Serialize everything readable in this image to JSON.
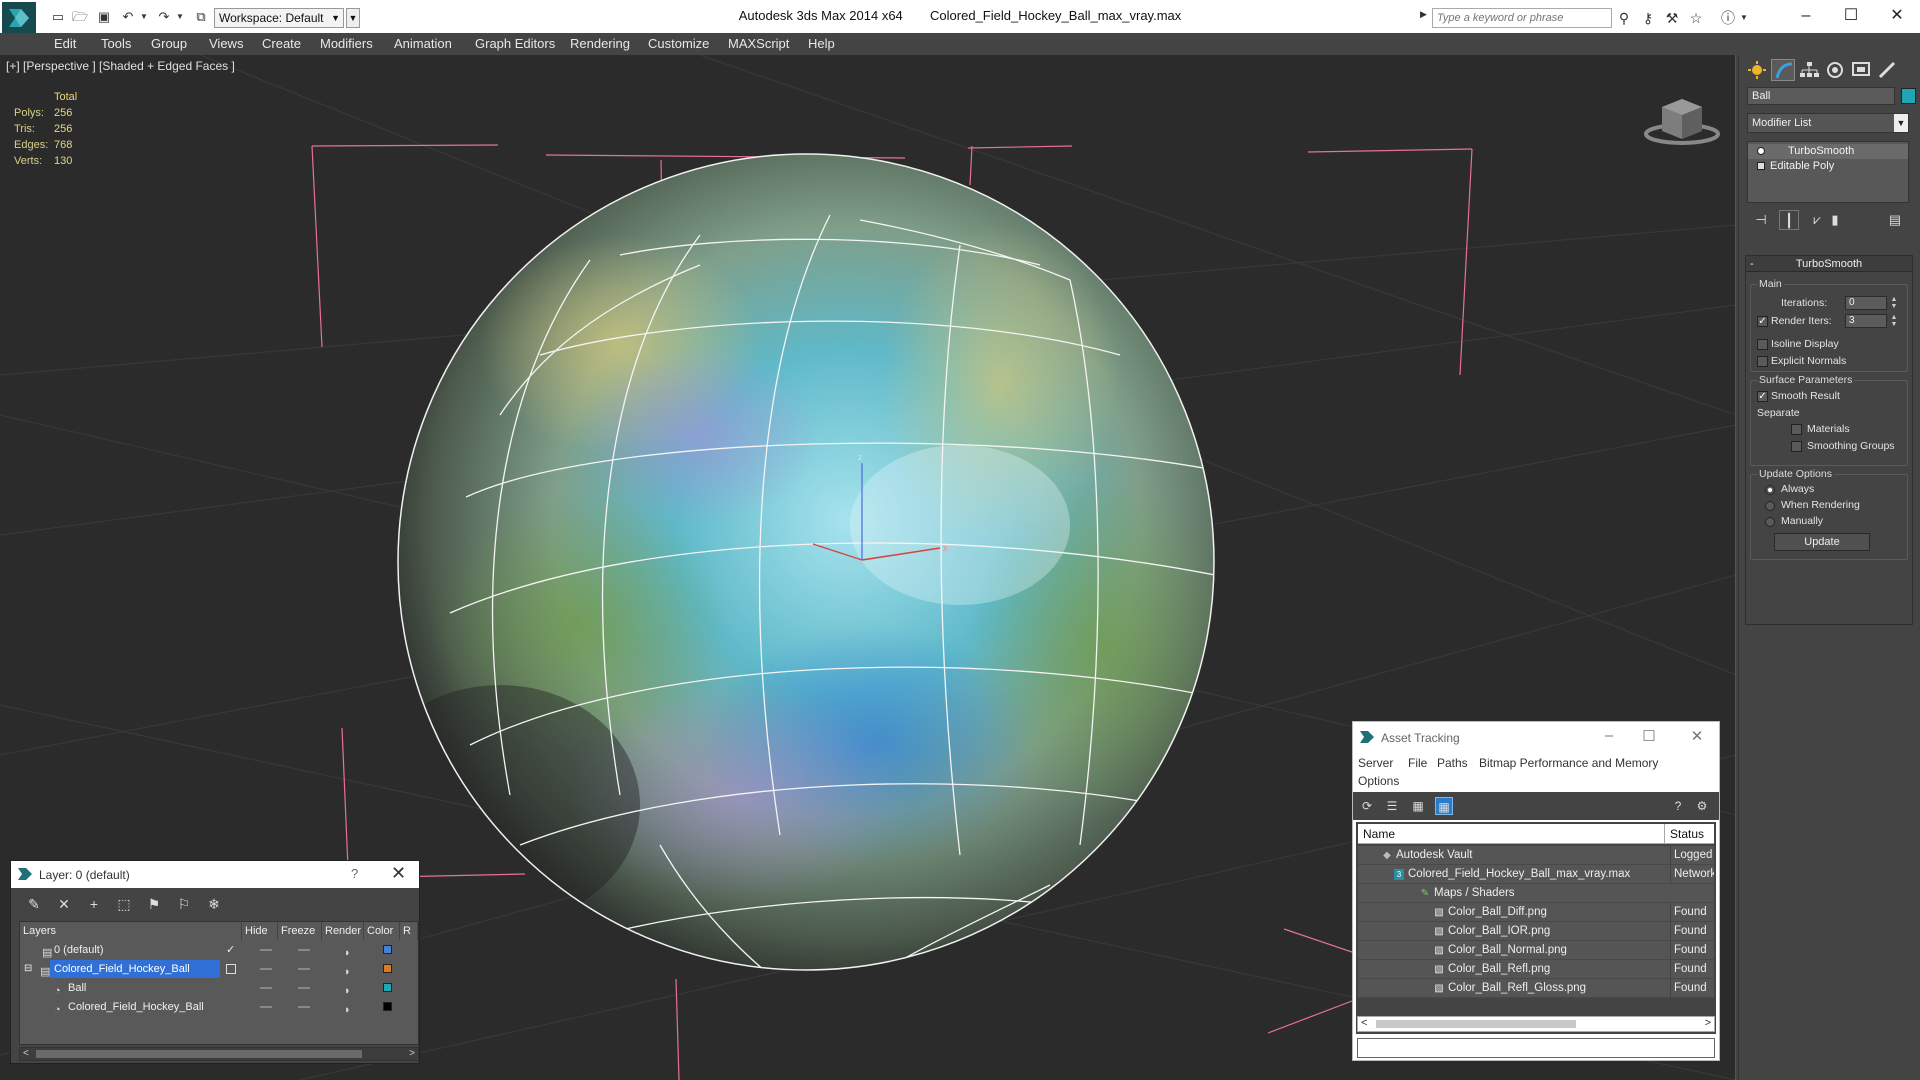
{
  "titlebar": {
    "workspace": "Workspace: Default",
    "app_title": "Autodesk 3ds Max  2014 x64",
    "file_name": "Colored_Field_Hockey_Ball_max_vray.max",
    "search_placeholder": "Type a keyword or phrase"
  },
  "menu": [
    "Edit",
    "Tools",
    "Group",
    "Views",
    "Create",
    "Modifiers",
    "Animation",
    "Graph Editors",
    "Rendering",
    "Customize",
    "MAXScript",
    "Help"
  ],
  "viewport": {
    "label": "[+] [Perspective ] [Shaded + Edged Faces ]",
    "stats": {
      "header": "Total",
      "rows": [
        {
          "key": "Polys:",
          "value": "256"
        },
        {
          "key": "Tris:",
          "value": "256"
        },
        {
          "key": "Edges:",
          "value": "768"
        },
        {
          "key": "Verts:",
          "value": "130"
        }
      ]
    },
    "axis_labels": {
      "z": "z",
      "x": "x"
    }
  },
  "command_panel": {
    "object_name": "Ball",
    "object_color": "#1fa7b5",
    "modifier_list": "Modifier List",
    "stack": [
      "TurboSmooth",
      "Editable Poly"
    ],
    "rollout_title": "TurboSmooth",
    "main_group": "Main",
    "iterations_label": "Iterations:",
    "iterations_value": "0",
    "render_iters_label": "Render Iters:",
    "render_iters_value": "3",
    "render_iters_checked": true,
    "isoline_label": "Isoline Display",
    "explicit_normals_label": "Explicit Normals",
    "surface_group": "Surface Parameters",
    "smooth_result_label": "Smooth Result",
    "separate_label": "Separate",
    "materials_label": "Materials",
    "smoothing_groups_label": "Smoothing Groups",
    "update_group": "Update Options",
    "update_always": "Always",
    "update_when_rendering": "When Rendering",
    "update_manually": "Manually",
    "update_button": "Update"
  },
  "layer_window": {
    "title": "Layer: 0 (default)",
    "help": "?",
    "columns": [
      "Layers",
      "Hide",
      "Freeze",
      "Render",
      "Color",
      "R"
    ],
    "rows": [
      {
        "name": "0 (default)",
        "color": "#4a7fd8",
        "indent": 0,
        "selected": false
      },
      {
        "name": "Colored_Field_Hockey_Ball",
        "color": "#e07a20",
        "indent": 0,
        "selected": true
      },
      {
        "name": "Ball",
        "color": "#1fa7b5",
        "indent": 1,
        "selected": false
      },
      {
        "name": "Colored_Field_Hockey_Ball",
        "color": "#000000",
        "indent": 1,
        "selected": false
      }
    ]
  },
  "asset_window": {
    "title": "Asset Tracking",
    "menu": [
      "Server",
      "File",
      "Paths",
      "Bitmap Performance and Memory",
      "Options"
    ],
    "columns": [
      "Name",
      "Status"
    ],
    "rows": [
      {
        "name": "Autodesk Vault",
        "status": "Logged C",
        "level": 0
      },
      {
        "name": "Colored_Field_Hockey_Ball_max_vray.max",
        "status": "Network",
        "level": 1
      },
      {
        "name": "Maps / Shaders",
        "status": "",
        "level": 2
      },
      {
        "name": "Color_Ball_Diff.png",
        "status": "Found",
        "level": 3
      },
      {
        "name": "Color_Ball_IOR.png",
        "status": "Found",
        "level": 3
      },
      {
        "name": "Color_Ball_Normal.png",
        "status": "Found",
        "level": 3
      },
      {
        "name": "Color_Ball_Refl.png",
        "status": "Found",
        "level": 3
      },
      {
        "name": "Color_Ball_Refl_Gloss.png",
        "status": "Found",
        "level": 3
      }
    ]
  }
}
